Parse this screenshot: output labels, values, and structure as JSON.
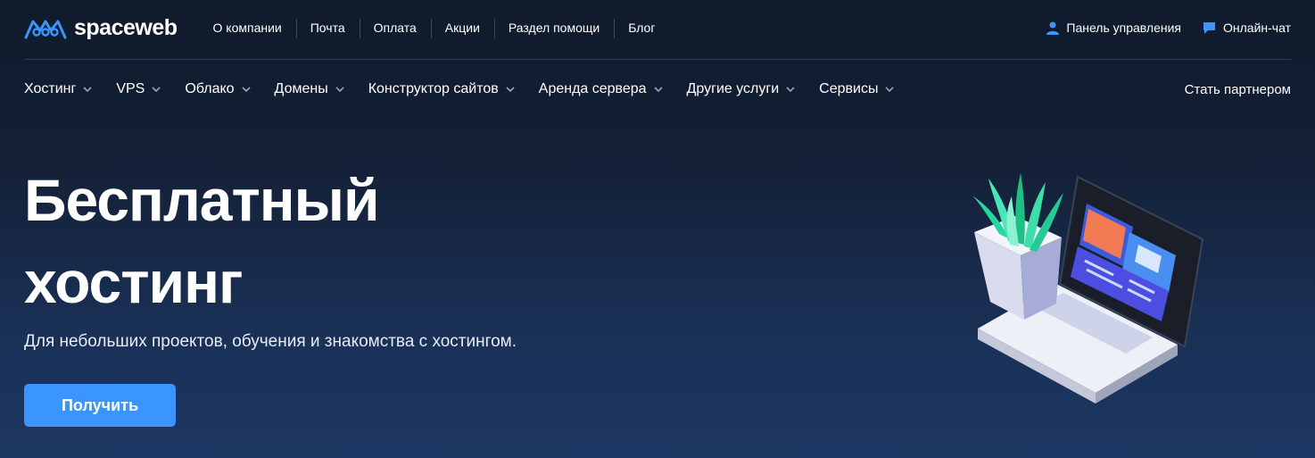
{
  "logo": {
    "text": "spaceweb",
    "icon": "spaceweb-logo-icon"
  },
  "top_nav": [
    "О компании",
    "Почта",
    "Оплата",
    "Акции",
    "Раздел помощи",
    "Блог"
  ],
  "top_right": {
    "panel": {
      "label": "Панель управления",
      "icon": "user-icon"
    },
    "chat": {
      "label": "Онлайн-чат",
      "icon": "chat-icon"
    }
  },
  "main_nav": [
    "Хостинг",
    "VPS",
    "Облако",
    "Домены",
    "Конструктор сайтов",
    "Аренда сервера",
    "Другие услуги",
    "Сервисы"
  ],
  "partner_link": "Стать партнером",
  "hero": {
    "title_line1": "Бесплатный",
    "title_line2": "хостинг",
    "subtitle": "Для небольших проектов, обучения и знакомства с хостингом.",
    "cta_label": "Получить"
  },
  "colors": {
    "accent": "#3b95ff",
    "bg_top": "#101a2c",
    "bg_bottom": "#1c3763"
  }
}
